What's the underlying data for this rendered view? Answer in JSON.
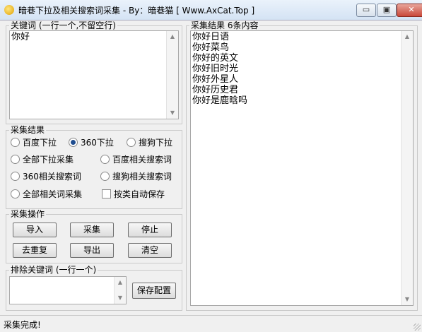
{
  "window": {
    "title": "暗巷下拉及相关搜索词采集 - By：暗巷猫 [ Www.AxCat.Top ]",
    "min_glyph": "▭",
    "max_glyph": "▣",
    "close_glyph": "✕"
  },
  "keywords": {
    "label": "关键词 (一行一个,不留空行)",
    "value": "你好"
  },
  "collect_results": {
    "label": "采集结果",
    "options": [
      {
        "label": "百度下拉",
        "checked": false
      },
      {
        "label": "360下拉",
        "checked": true
      },
      {
        "label": "搜狗下拉",
        "checked": false
      },
      {
        "label": "全部下拉采集",
        "checked": false
      },
      {
        "label": "百度相关搜索词",
        "checked": false
      },
      {
        "label": "360相关搜索词",
        "checked": false
      },
      {
        "label": "搜狗相关搜索词",
        "checked": false
      },
      {
        "label": "全部相关词采集",
        "checked": false
      }
    ],
    "auto_save_label": "按类自动保存",
    "auto_save_checked": false
  },
  "actions": {
    "label": "采集操作",
    "import": "导入",
    "collect": "采集",
    "stop": "停止",
    "dedupe": "去重复",
    "export": "导出",
    "clear": "清空"
  },
  "exclude": {
    "label": "排除关键词 (一行一个)",
    "value": "",
    "save_config": "保存配置"
  },
  "results": {
    "label": "采集结果 6条内容",
    "lines": "你好日语\n你好菜鸟\n你好的英文\n你好旧时光\n你好外星人\n你好历史君\n你好是鹿晗吗"
  },
  "status": {
    "text": "采集完成!"
  },
  "icons": {
    "app": "app-icon",
    "scroll_up": "▲",
    "scroll_down": "▼"
  }
}
